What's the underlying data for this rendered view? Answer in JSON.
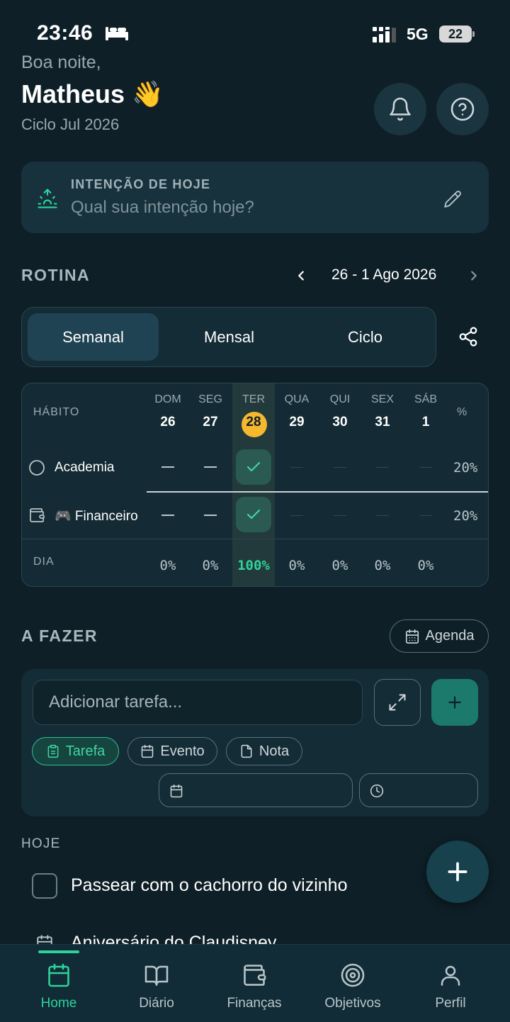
{
  "status_bar": {
    "time": "23:46",
    "network": "5G",
    "battery": "22"
  },
  "header": {
    "greeting": "Boa noite,",
    "user_name": "Matheus 👋",
    "cycle": "Ciclo Jul 2026"
  },
  "intention": {
    "label": "INTENÇÃO DE HOJE",
    "placeholder": "Qual sua intenção hoje?"
  },
  "routine": {
    "title": "ROTINA",
    "date_range": "26 - 1 Ago 2026",
    "tabs": [
      {
        "label": "Semanal",
        "active": true
      },
      {
        "label": "Mensal",
        "active": false
      },
      {
        "label": "Ciclo",
        "active": false
      }
    ],
    "table": {
      "habit_header": "HÁBITO",
      "percent_header": "%",
      "days": [
        {
          "name": "DOM",
          "num": "26"
        },
        {
          "name": "SEG",
          "num": "27"
        },
        {
          "name": "TER",
          "num": "28",
          "today": true
        },
        {
          "name": "QUA",
          "num": "29"
        },
        {
          "name": "QUI",
          "num": "30"
        },
        {
          "name": "SEX",
          "num": "31"
        },
        {
          "name": "SÁB",
          "num": "1"
        }
      ],
      "habits": [
        {
          "name": "Academia",
          "percent": "20%"
        },
        {
          "name": "🎮 Financeiro",
          "percent": "20%"
        }
      ],
      "day_row_label": "DIA",
      "day_percents": [
        "0%",
        "0%",
        "100%",
        "0%",
        "0%",
        "0%",
        "0%"
      ]
    }
  },
  "todo": {
    "title": "A FAZER",
    "agenda_label": "Agenda",
    "input_placeholder": "Adicionar tarefa...",
    "chips": [
      {
        "label": "Tarefa",
        "active": true
      },
      {
        "label": "Evento",
        "active": false
      },
      {
        "label": "Nota",
        "active": false
      }
    ],
    "today_title": "HOJE",
    "items": [
      {
        "text": "Passear com o cachorro do vizinho"
      },
      {
        "text": "Aniversário do Claudisney"
      }
    ]
  },
  "nav": {
    "items": [
      {
        "label": "Home",
        "icon": "calendar-icon",
        "active": true
      },
      {
        "label": "Diário",
        "icon": "book-icon"
      },
      {
        "label": "Finanças",
        "icon": "wallet-icon"
      },
      {
        "label": "Objetivos",
        "icon": "target-icon"
      },
      {
        "label": "Perfil",
        "icon": "user-icon"
      }
    ]
  },
  "colors": {
    "background": "#0e1f27",
    "accent": "#2fd39a",
    "today_badge": "#f5b82e",
    "card": "#142c36"
  }
}
